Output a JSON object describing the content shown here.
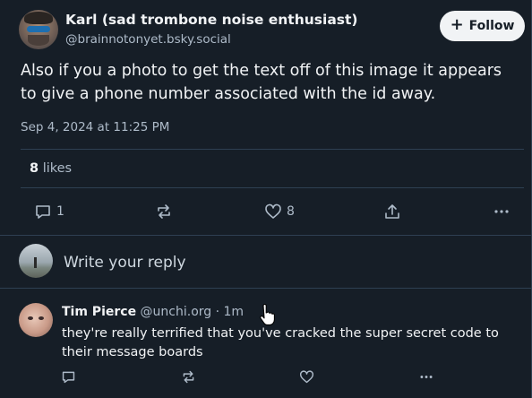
{
  "post": {
    "author_name": "Karl (sad trombone noise enthusiast)",
    "author_handle": "@brainnotonyet.bsky.social",
    "follow_label": "Follow",
    "text": "Also if you a photo to get the text off of this image it appears to give a phone number associated with the id away.",
    "date": "Sep 4, 2024 at 11:25 PM",
    "likes_count": "8",
    "likes_label": "likes",
    "actions": {
      "reply_count": "1",
      "like_count": "8"
    }
  },
  "reply_box": {
    "placeholder": "Write your reply"
  },
  "reply": {
    "author_name": "Tim Pierce",
    "author_handle": "@unchi.org",
    "separator": " · ",
    "time": "1m",
    "text": "they're really terrified that you've cracked the super secret code to their message boards"
  },
  "colors": {
    "background": "#161e27",
    "text": "#f1f3f5",
    "muted": "#aebbc9",
    "divider": "#2e4052",
    "follow_button_bg": "#f1f3f5"
  },
  "icons": [
    "plus-icon",
    "reply-icon",
    "repost-icon",
    "heart-icon",
    "share-icon",
    "more-icon",
    "cursor-hand-icon"
  ]
}
